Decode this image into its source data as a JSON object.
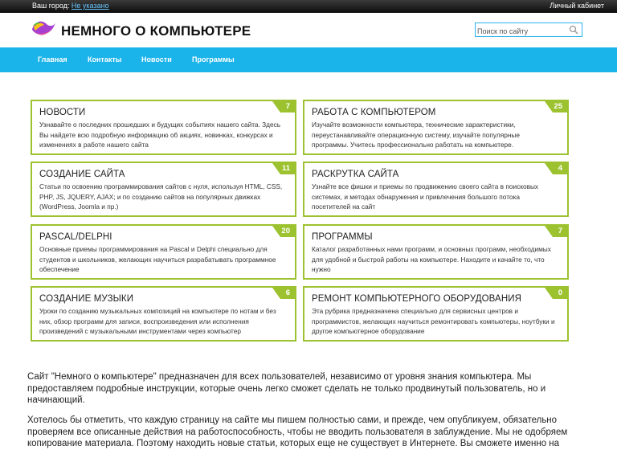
{
  "topbar": {
    "city_label": "Ваш город:",
    "city_value": "Не указано",
    "cabinet": "Личный кабинет"
  },
  "header": {
    "title": "НЕМНОГО О КОМПЬЮТЕРЕ",
    "search_placeholder": "Поиск по сайту"
  },
  "nav": [
    "Главная",
    "Контакты",
    "Новости",
    "Программы"
  ],
  "cards": [
    {
      "title": "Новости",
      "count": "7",
      "desc": "Узнавайте о последних прошедших и будущих событиях нашего сайта. Здесь Вы найдете всю подробную информацию об акциях, новинках, конкурсах и изменениях в работе нашего сайта"
    },
    {
      "title": "Работа с компьютером",
      "count": "25",
      "desc": "Изучайте возможности компьютера, технические характеристики, переустанавливайте операционную систему, изучайте популярные программы. Учитесь профессионально работать на компьютере."
    },
    {
      "title": "Создание сайта",
      "count": "11",
      "desc": "Статьи по освоению программирования сайтов с нуля, используя HTML, CSS, PHP, JS, JQUERY, AJAX; и по созданию сайтов на популярных движках (WordPress, Joomla и пр.)"
    },
    {
      "title": "Раскрутка сайта",
      "count": "4",
      "desc": "Узнайте все фишки и приемы по продвижению своего сайта в поисковых системах, и методах обнаружения и привлечения большого потока посетителей на сайт"
    },
    {
      "title": "Pascal/Delphi",
      "count": "20",
      "desc": "Основные приемы программирования на Pascal и Delphi специально для студентов и школьников, желающих научиться разрабатывать программное обеспечение"
    },
    {
      "title": "Программы",
      "count": "7",
      "desc": "Каталог разработанных нами программ, и основных программ, необходимых для удобной и быстрой работы на компьютере. Находите и качайте то, что нужно"
    },
    {
      "title": "Создание музыки",
      "count": "6",
      "desc": "Уроки по созданию музыкальных композиций на компьютере по нотам и без них, обзор программ для записи, воспроизведения или исполнения произведений с музыкальными инструментами через компьютер"
    },
    {
      "title": "Ремонт компьютерного оборудования",
      "count": "0",
      "desc": "Эта рубрика предназначена специально для сервисных центров и программистов, желающих научиться ремонтировать компьютеры, ноутбуки и другое компьютерное оборудование"
    }
  ],
  "intro": {
    "p1": "Сайт \"Немного о компьютере\" предназначен для всех пользователей, независимо от уровня знания компьютера. Мы предоставляем подробные инструкции, которые очень легко сможет сделать не только продвинутый пользователь, но и начинающий.",
    "p2": "Хотелось бы отметить, что каждую страницу на сайте мы пишем полностью сами, и прежде, чем опубликуем, обязательно проверяем все описанные действия на работоспособность, чтобы не вводить пользователя в заблуждение. Мы не одобряем копирование материала. Поэтому находить новые статьи, которых еще не существует в Интернете. Вы сможете именно на"
  },
  "colors": {
    "accent_blue": "#1bb4ea",
    "card_green": "#9cc22f"
  }
}
